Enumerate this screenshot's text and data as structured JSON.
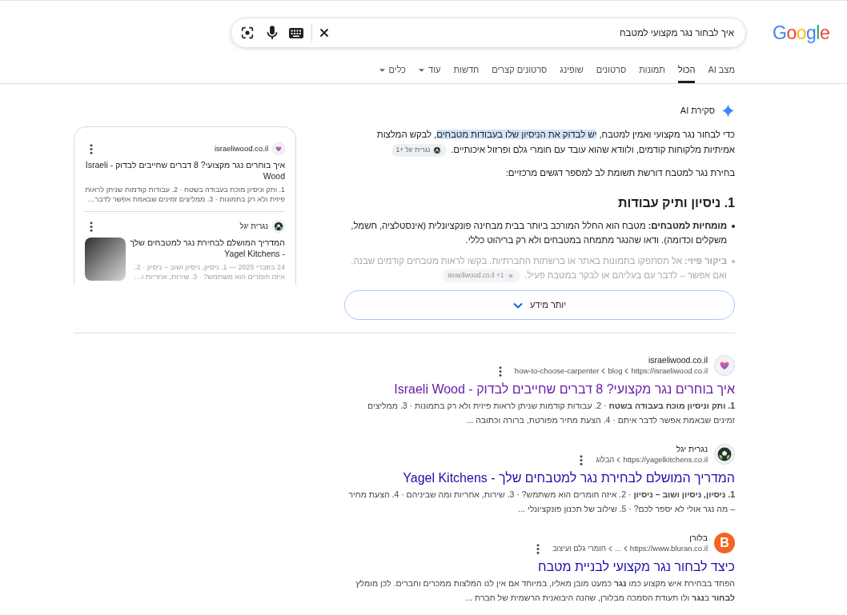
{
  "logo": "Google",
  "search": {
    "value": "איך לבחור נגר מקצועי למטבח"
  },
  "tabs": [
    {
      "label": "מצב AI",
      "selected": false,
      "dropdown": false
    },
    {
      "label": "הכול",
      "selected": true,
      "dropdown": false
    },
    {
      "label": "תמונות",
      "selected": false,
      "dropdown": false
    },
    {
      "label": "סרטונים",
      "selected": false,
      "dropdown": false
    },
    {
      "label": "שופינג",
      "selected": false,
      "dropdown": false
    },
    {
      "label": "סרטונים קצרים",
      "selected": false,
      "dropdown": false
    },
    {
      "label": "חדשות",
      "selected": false,
      "dropdown": false
    },
    {
      "label": "עוד",
      "selected": false,
      "dropdown": true
    },
    {
      "label": "כלים",
      "selected": false,
      "dropdown": true
    }
  ],
  "ai_overview": {
    "title": "סקירת AI",
    "intro": {
      "segments": [
        {
          "text": "כדי לבחור נגר מקצועי ואמין למטבח, ",
          "highlighted": false
        },
        {
          "text": "יש לבדוק את הניסיון שלו בעבודות מטבחים",
          "highlighted": true
        },
        {
          "text": ", לבקש המלצות אמיתיות מלקוחות קודמים, ולוודא שהוא עובד עם חומרי גלם ופרזול איכותיים.",
          "highlighted": false
        }
      ],
      "chip": {
        "kind": "ball",
        "label": "נגרית יגל +1"
      }
    },
    "lead": "בחירת נגר למטבח דורשת תשומת לב למספר דגשים מרכזיים:",
    "heading": "1. ניסיון ותיק עבודות",
    "bullets": [
      {
        "text": "**מומחיות למטבחים:** מטבח הוא החלל המורכב ביותר בבית מבחינה פונקציונלית (אינסטלציה, חשמל, משקלים וכדומה). ודאו שהנגר מתמחה במטבחים ולא רק בריהוט כללי.",
        "faded": false
      },
      {
        "text": "**ביקור פיזי:** אל תסתפקו בתמונות באתר או ברשתות החברתיות. בקשו לראות מטבחים קודמים שבנה, ואם אפשר – לדבר עם בעליהם או לבקר במטבח פעיל.",
        "faded": true,
        "chip": {
          "kind": "heart",
          "label": "israeliwood.co.il +1"
        }
      }
    ],
    "more_button": "יותר מידע"
  },
  "sources_panel": {
    "cards": [
      {
        "kind": "heart",
        "site": "israeliwood.co.il",
        "title": "איך בוחרים נגר מקצועי? 8 דברים שחייבים לבדוק - Israeli Wood",
        "snippet": "1. ותק וניסיון מוכח בעבודה בשטח · 2. עבודות קודמות שניתן לראות פיזית ולא רק בתמונות · 3. ממליצים זמינים שבאמת אפשר לדבר…",
        "thumbnail": false
      },
      {
        "kind": "ball",
        "site": "נגרית יגל",
        "title": "המדריך המושלם לבחירת נגר למטבחים שלך - Yagel Kitchens",
        "snippet": "24 בפברי 2025 — 1. ניסיון, ניסיון ושוב – ניסיון · 2. איזה חומרים הוא משתמש? · 3. שירות, אחריות ו…",
        "thumbnail": true
      }
    ]
  },
  "results": [
    {
      "kind": "heart",
      "site": "israeliwood.co.il",
      "breadcrumbs": [
        "https://israeliwood.co.il",
        "blog",
        "how-to-choose-carpenter"
      ],
      "title": "איך בוחרים נגר מקצועי? 8 דברים שחייבים לבדוק - Israeli Wood",
      "visited": true,
      "snippet": "**1. ותק וניסיון מוכח בעבודה בשטח** · 2. עבודות קודמות שניתן לראות פיזית ולא רק בתמונות · 3. ממליצים זמינים שבאמת אפשר לדבר איתם · 4. הצעת מחיר מפורטת, ברורה וכתובה ..."
    },
    {
      "kind": "ball",
      "site": "נגרית יגל",
      "breadcrumbs": [
        "https://yagelkitchens.co.il",
        "הבלוג"
      ],
      "title": "המדריך המושלם לבחירת נגר למטבחים שלך - Yagel Kitchens",
      "visited": false,
      "snippet": "**1. ניסיון, ניסיון ושוב – ניסיון** · 2. איזה חומרים הוא משתמש? · 3. שירות, אחריות ומה שביניהם · 4. הצעת מחיר – מה נגר אולי לא יספר לכם? · 5. שילוב של תכנון פונקציונלי ..."
    },
    {
      "kind": "letter",
      "logo_letter": "B",
      "site": "בלורן",
      "breadcrumbs": [
        "https://www.bluran.co.il",
        "...",
        "חומרי גלם ועיצוב"
      ],
      "title": "כיצד לבחור נגר מקצועי לבניית מטבח",
      "visited": false,
      "snippet": "הפחד בבחירת איש מקצוע כמו **נגר** כמעט מובן מאליו, במיוחד אם אין לנו המלצות ממכרים וחברים. לכן מומלץ **לבחור** ב**נגר** ולו תעודת הסמכה מבלורן, שהנה היבואנית הרשמית של חברת ..."
    }
  ]
}
